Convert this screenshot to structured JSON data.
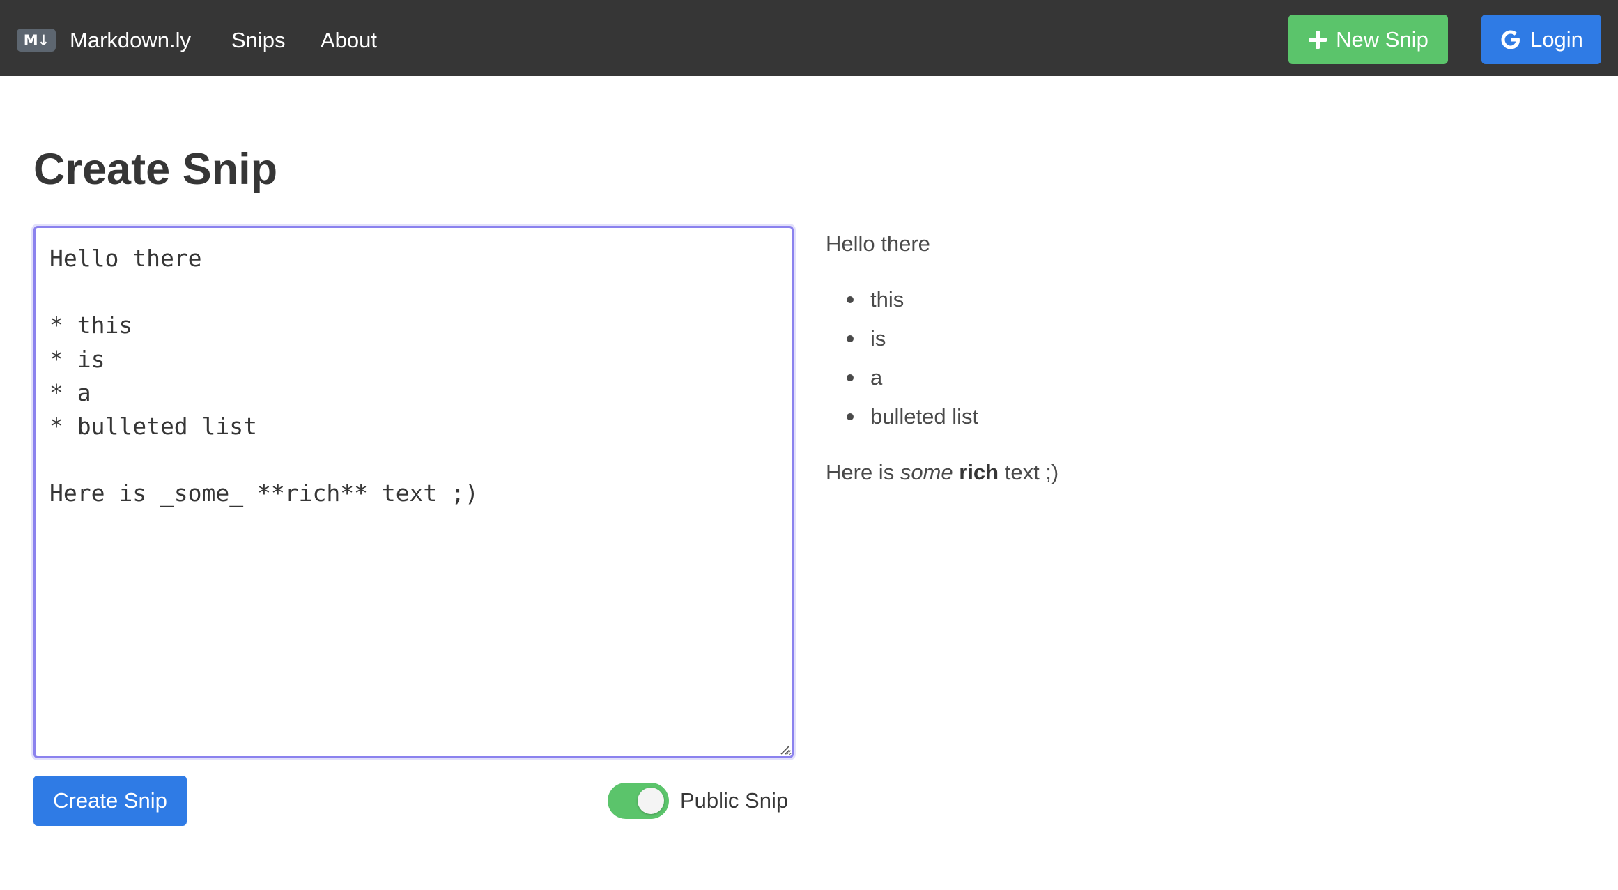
{
  "navbar": {
    "logo_text": "M↓",
    "brand": "Markdown.ly",
    "links": [
      "Snips",
      "About"
    ],
    "new_snip_label": "New Snip",
    "login_label": "Login",
    "new_snip_icon": "plus-icon",
    "login_icon": "google-icon"
  },
  "page": {
    "title": "Create Snip"
  },
  "editor": {
    "value": "Hello there\n\n* this\n* is\n* a\n* bulleted list\n\nHere is _some_ **rich** text ;)"
  },
  "controls": {
    "create_label": "Create Snip",
    "public_toggle_on": true,
    "public_label": "Public Snip"
  },
  "preview": {
    "intro": "Hello there",
    "list": [
      "this",
      "is",
      "a",
      "bulleted list"
    ],
    "rich": {
      "before": "Here is ",
      "italic": "some",
      "middle": " ",
      "bold": "rich",
      "after": " text ;)"
    }
  },
  "colors": {
    "navbar_bg": "#363636",
    "success": "#5bc46b",
    "primary": "#2f7be5",
    "focus_border": "#8b82ee",
    "text": "#363636"
  }
}
